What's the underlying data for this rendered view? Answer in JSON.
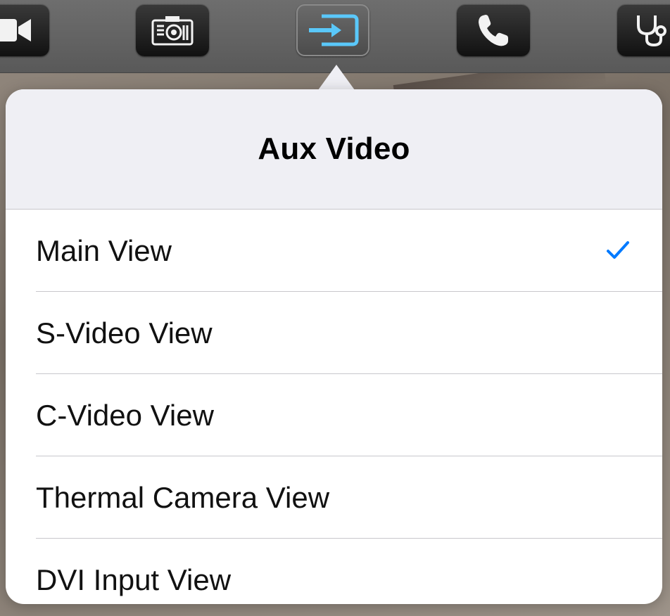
{
  "toolbar": {
    "buttons": [
      {
        "icon": "video-camera-icon"
      },
      {
        "icon": "camera-icon"
      },
      {
        "icon": "input-source-icon",
        "active": true
      },
      {
        "icon": "phone-icon"
      },
      {
        "icon": "stethoscope-icon"
      }
    ],
    "active_color": "#5ac8fa"
  },
  "popover": {
    "title": "Aux Video",
    "options": [
      {
        "label": "Main View",
        "selected": true
      },
      {
        "label": "S-Video View",
        "selected": false
      },
      {
        "label": "C-Video View",
        "selected": false
      },
      {
        "label": "Thermal Camera View",
        "selected": false
      },
      {
        "label": "DVI Input View",
        "selected": false
      }
    ],
    "check_color": "#007aff"
  }
}
